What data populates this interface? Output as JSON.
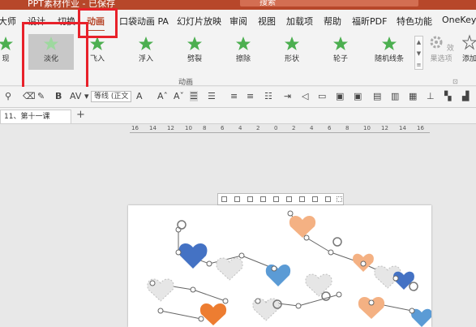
{
  "window": {
    "title": "PPT素材作业 - 已保存",
    "search_label": "搜索"
  },
  "tabs": [
    {
      "label": "大师",
      "active": false
    },
    {
      "label": "设计",
      "active": false
    },
    {
      "label": "切换",
      "active": false
    },
    {
      "label": "动画",
      "active": true
    },
    {
      "label": "口袋动画 PA",
      "active": false
    },
    {
      "label": "幻灯片放映",
      "active": false
    },
    {
      "label": "审阅",
      "active": false
    },
    {
      "label": "视图",
      "active": false
    },
    {
      "label": "加载项",
      "active": false
    },
    {
      "label": "帮助",
      "active": false
    },
    {
      "label": "福昕PDF",
      "active": false
    },
    {
      "label": "特色功能",
      "active": false
    },
    {
      "label": "OneKey",
      "active": false
    }
  ],
  "animations": {
    "group_label": "动画",
    "effects": [
      {
        "label": "现",
        "selected": false
      },
      {
        "label": "淡化",
        "selected": true
      },
      {
        "label": "飞入",
        "selected": false
      },
      {
        "label": "浮入",
        "selected": false
      },
      {
        "label": "劈裂",
        "selected": false
      },
      {
        "label": "擦除",
        "selected": false
      },
      {
        "label": "形状",
        "selected": false
      },
      {
        "label": "轮子",
        "selected": false
      },
      {
        "label": "随机线条",
        "selected": false
      }
    ],
    "effect_options_label": "效果选项",
    "add_animation_label": "添加",
    "star_color": "#4caf50"
  },
  "format": {
    "font_name": "等线 (正文"
  },
  "document_tab": {
    "label": "11、第十一课"
  },
  "ruler": {
    "labels": [
      "16",
      "14",
      "12",
      "10",
      "8",
      "6",
      "4",
      "2",
      "0",
      "2",
      "4",
      "6",
      "8",
      "10",
      "12",
      "14",
      "16"
    ]
  },
  "colors": {
    "accent": "#b7472a",
    "highlight_red": "#e8212a",
    "heart_blue": "#4472c4",
    "heart_orange": "#f4b183",
    "heart_deep_orange": "#ed7d31"
  }
}
